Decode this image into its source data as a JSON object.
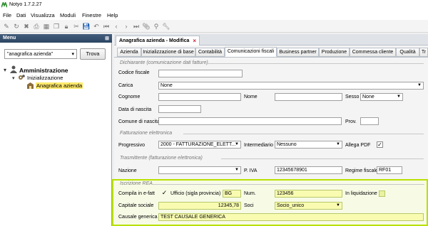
{
  "window": {
    "title": "Notyo 1.7.2.27"
  },
  "menubar": [
    "File",
    "Dati",
    "Visualizza",
    "Moduli",
    "Finestre",
    "Help"
  ],
  "sidebar": {
    "header": "Menu",
    "search_value": "\"anagrafica azienda\"",
    "search_button": "Trova",
    "tree": {
      "root": "Amministrazione",
      "child": "Inizializzazione",
      "leaf": "Anagrafica azienda"
    }
  },
  "document_tab": {
    "label": "Anagrafica azienda - Modifica",
    "close": "×"
  },
  "tabs": [
    "Azienda",
    "Inizializzazione di base",
    "Contabilità",
    "Comunicazioni fiscali",
    "Business partner",
    "Produzione",
    "Commessa cliente",
    "Qualità",
    "Tr"
  ],
  "active_tab": "Comunicazioni fiscali",
  "dichiarante": {
    "title": "Dichiarante (comunicazione dati fatture)",
    "codice_fiscale_label": "Codice fiscale",
    "codice_fiscale_value": "",
    "carica_label": "Carica",
    "carica_value": "None",
    "cognome_label": "Cognome",
    "nome_label": "Nome",
    "sesso_label": "Sesso",
    "sesso_value": "None",
    "data_nascita_label": "Data di nascita",
    "comune_nascita_label": "Comune di nascita",
    "prov_label": "Prov."
  },
  "fatturazione": {
    "title": "Fatturazione elettronica",
    "progressivo_label": "Progressivo",
    "progressivo_value": "2000 - FATTURAZIONE_ELETT...",
    "intermediario_label": "Intermediario",
    "intermediario_value": "Nessuno",
    "allega_pdf_label": "Allega PDF",
    "allega_pdf_checked": "✓"
  },
  "trasmittente": {
    "title": "Trasmittente (fatturazione elettronica)",
    "nazione_label": "Nazione",
    "piva_label": "P. IVA",
    "piva_value": "12345678901",
    "regime_label": "Regime fiscale",
    "regime_value": "RF01"
  },
  "rea": {
    "title": "Iscrizione REA",
    "compila_label": "Compila in e-fatt",
    "compila_checked": "✓",
    "ufficio_label": "Ufficio (sigla provincia)",
    "ufficio_value": "BG",
    "num_label": "Num.",
    "num_value": "123456",
    "liquidazione_label": "In liquidazione",
    "capitale_label": "Capitale sociale",
    "capitale_value": "12345,78",
    "soci_label": "Soci",
    "soci_value": "Socio_unico",
    "causale_label": "Causale generica",
    "causale_value": "TEST CAUSALE GENERICA"
  }
}
